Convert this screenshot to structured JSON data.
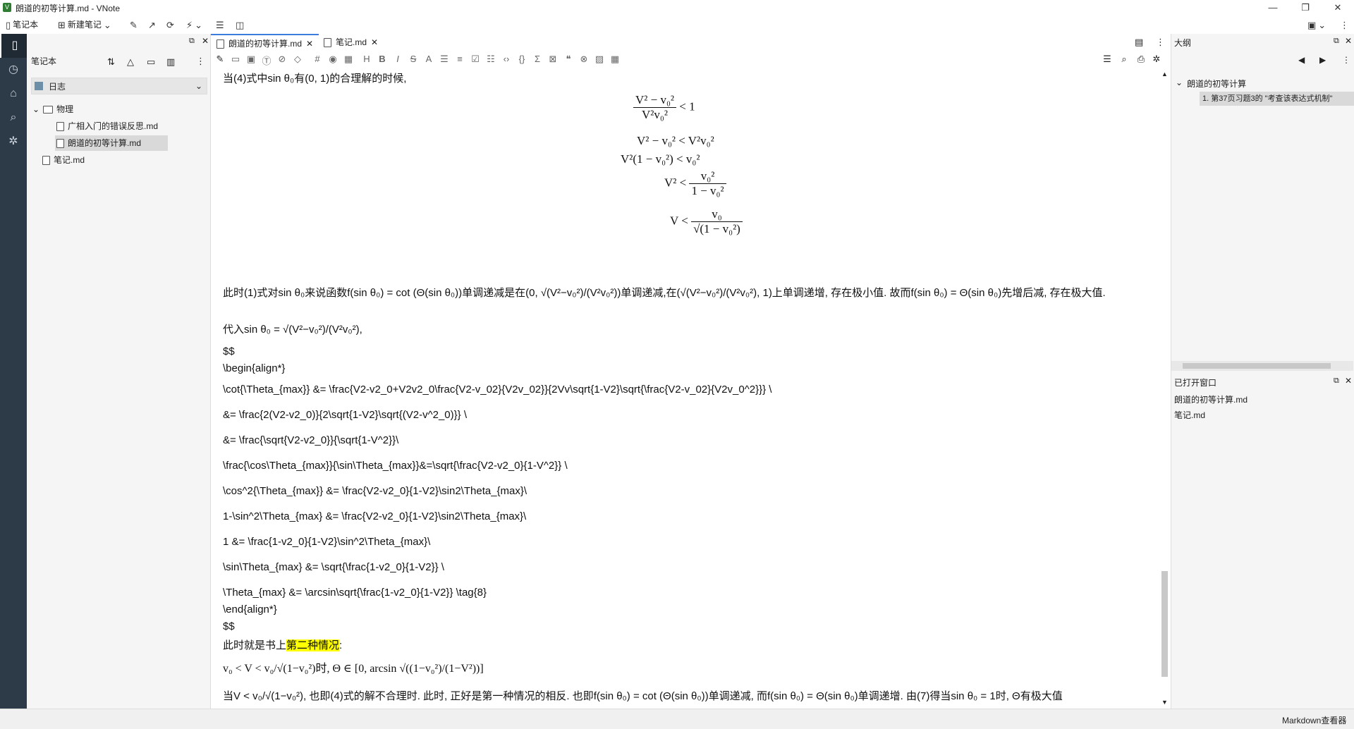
{
  "window": {
    "title": "朗道的初等计算.md - VNote",
    "app_icon": "V"
  },
  "menubar": {
    "notebook_label": "笔记本",
    "new_note_label": "新建笔记"
  },
  "navpanel": {
    "header": "笔记本",
    "notebook_selected": "日志",
    "tree": {
      "folder": "物理",
      "file1": "广相入门的错误反思.md",
      "file2": "朗道的初等计算.md",
      "file3": "笔记.md"
    }
  },
  "tabs": [
    {
      "label": "朗道的初等计算.md"
    },
    {
      "label": "笔记.md"
    }
  ],
  "content": {
    "line1": "当(4)式中sin θ₀有(0, 1)的合理解的时候,",
    "eq1": "< 1",
    "eq2": "V² − v₀² < V²v₀²",
    "eq3": "V²(1 − v₀²) < v₀²",
    "eq4": "V² <",
    "eq5": "V <",
    "para1": "此时(1)式对sin θ₀来说函数f(sin θ₀) = cot (Θ(sin θ₀))单调递减是在(0, √(V²−v₀²)/(V²v₀²))单调递减,在(√(V²−v₀²)/(V²v₀²), 1)上单调递增, 存在极小值. 故而f(sin θ₀) = Θ(sin θ₀)先增后减, 存在极大值.",
    "para2": "代入sin θ₀ = √(V²−v₀²)/(V²v₀²),",
    "dd1": "$$",
    "begin": "\\begin{align*}",
    "l1": "\\cot{\\Theta_{max}} &= \\frac{V2-v2_0+V2v2_0\\frac{V2-v_02}{V2v_02}}{2Vv\\sqrt{1-V2}\\sqrt{\\frac{V2-v_02}{V2v_0^2}}} \\",
    "l2": "&= \\frac{2(V2-v2_0)}{2\\sqrt{1-V2}\\sqrt{(V2-v^2_0)}} \\",
    "l3": "&= \\frac{\\sqrt{V2-v2_0}}{\\sqrt{1-V^2}}\\",
    "l4": "\\frac{\\cos\\Theta_{max}}{\\sin\\Theta_{max}}&=\\sqrt{\\frac{V2-v2_0}{1-V^2}} \\",
    "l5": "\\cos^2{\\Theta_{max}} &= \\frac{V2-v2_0}{1-V2}\\sin2\\Theta_{max}\\",
    "l6": "1-\\sin^2\\Theta_{max} &= \\frac{V2-v2_0}{1-V2}\\sin2\\Theta_{max}\\",
    "l7": "1 &= \\frac{1-v2_0}{1-V2}\\sin^2\\Theta_{max}\\",
    "l8": "\\sin\\Theta_{max} &= \\sqrt{\\frac{1-v2_0}{1-V2}} \\",
    "l9": "\\Theta_{max} &= \\arcsin\\sqrt{\\frac{1-v2_0}{1-V2}} \\tag{8}",
    "end": "\\end{align*}",
    "dd2": "$$",
    "para3_pre": "此时就是书上",
    "para3_hl": "第二种情况",
    "para3_post": ":",
    "para4": "v₀ < V < v₀/√(1−v₀²)时, Θ ∈ [0, arcsin √((1−v₀²)/(1−V²))]",
    "para5": "当V < v₀/√(1−v₀²), 也即(4)式的解不合理时. 此时, 正好是第一种情况的相反. 也即f(sin θ₀) = cot (Θ(sin θ₀))单调递减, 而f(sin θ₀) = Θ(sin θ₀)单调递增. 由(7)得当sin θ₀ = 1时, Θ有极大值"
  },
  "outline": {
    "title": "大纲",
    "root": "朗道的初等计算",
    "item1": "1. 第37页习题3的 \"考查该表达式机制\""
  },
  "openwindows": {
    "title": "已打开窗口",
    "item1": "朗道的初等计算.md",
    "item2": "笔记.md"
  },
  "statusbar": {
    "mode": "Markdown查看器"
  }
}
